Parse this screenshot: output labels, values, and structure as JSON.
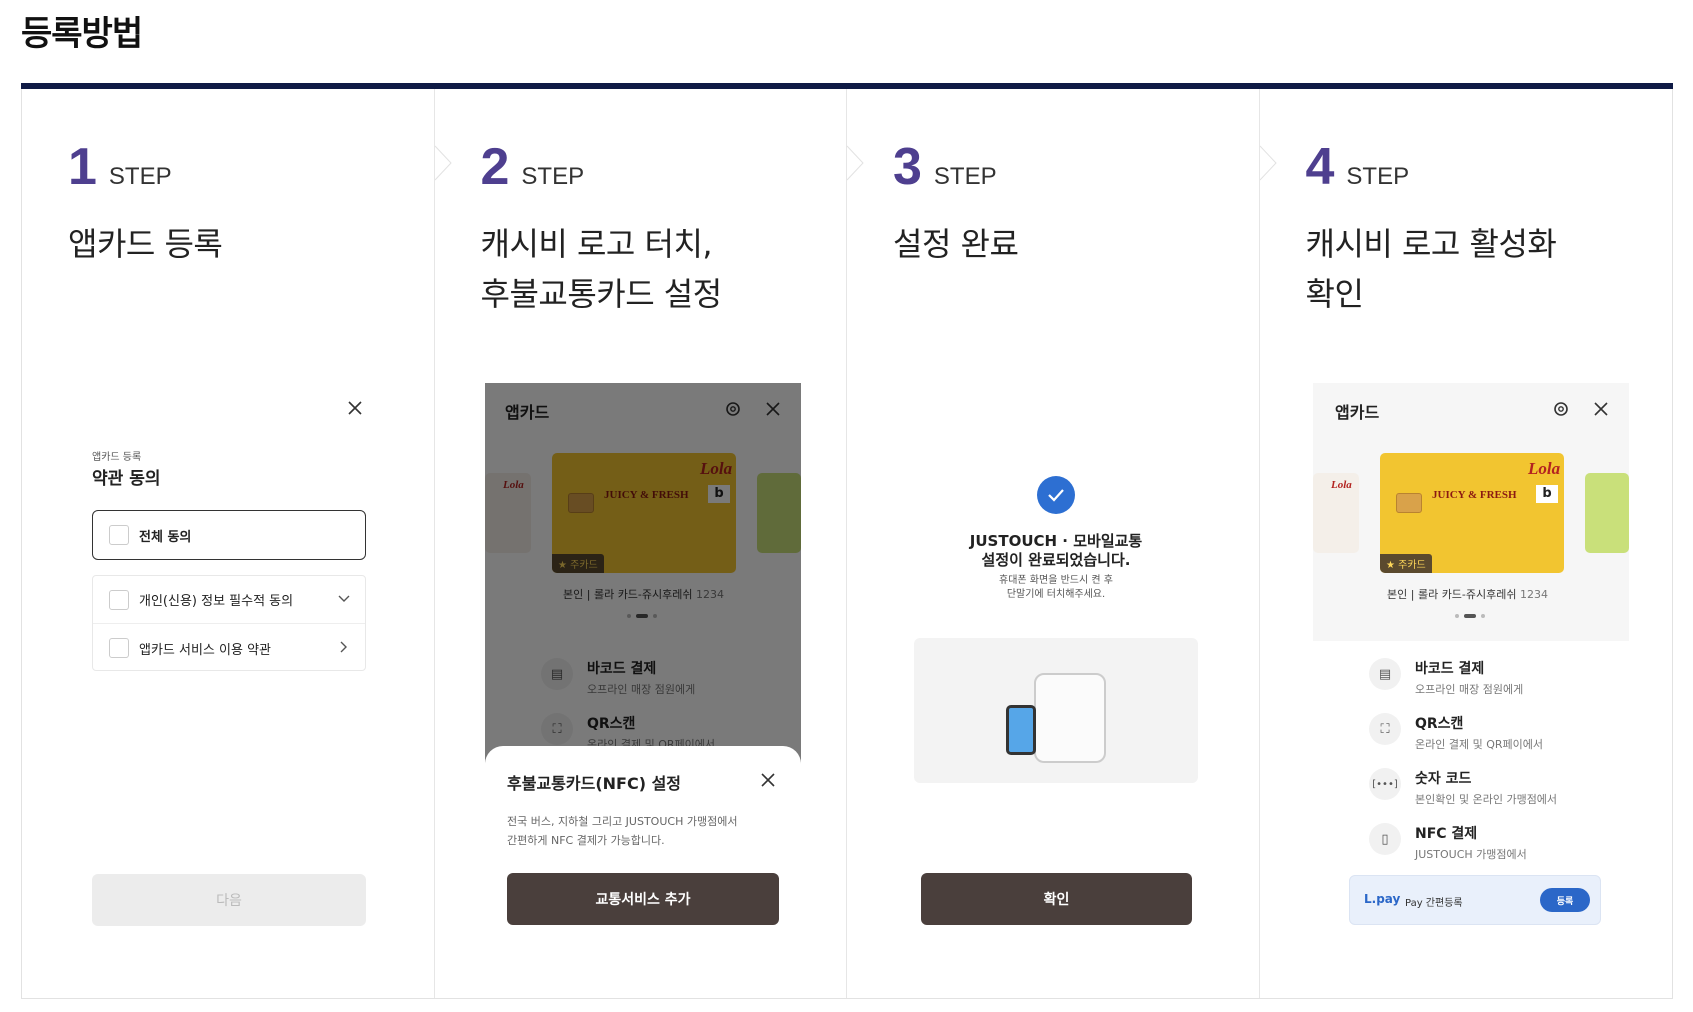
{
  "page": {
    "title": "등록방법"
  },
  "steps": [
    {
      "num": "1",
      "word": "STEP",
      "title_lines": [
        "앱카드 등록"
      ]
    },
    {
      "num": "2",
      "word": "STEP",
      "title_lines": [
        "캐시비 로고 터치,",
        "후불교통카드 설정"
      ]
    },
    {
      "num": "3",
      "word": "STEP",
      "title_lines": [
        "설정 완료"
      ]
    },
    {
      "num": "4",
      "word": "STEP",
      "title_lines": [
        "캐시비 로고 활성화",
        "확인"
      ]
    }
  ],
  "step1": {
    "sub": "앱카드 등록",
    "heading": "약관 동의",
    "all_agree": "전체 동의",
    "terms": [
      "개인(신용) 정보 필수적 동의",
      "앱카드 서비스 이용 약관"
    ],
    "next_button": "다음"
  },
  "appcard": {
    "title": "앱카드",
    "card_brand": "Lola",
    "card_art_text": "JUICY & FRESH",
    "main_badge": "★ 주카드",
    "owner_label": "본인",
    "card_name": "롤라 카드-쥬시후레쉬",
    "card_last4": "1234",
    "menu": [
      {
        "icon": "barcode-icon",
        "title": "바코드 결제",
        "desc": "오프라인 매장 점원에게"
      },
      {
        "icon": "qr-scan-icon",
        "title": "QR스캔",
        "desc": "온라인 결제 및 QR페이에서"
      },
      {
        "icon": "number-code-icon",
        "title": "숫자 코드",
        "desc": "본인확인 및 온라인 가맹점에서"
      },
      {
        "icon": "nfc-icon",
        "title": "NFC 결제",
        "desc": "JUSTOUCH 가맹점에서"
      }
    ]
  },
  "step2": {
    "sheet_title": "후불교통카드(NFC) 설정",
    "sheet_desc_lines": [
      "전국 버스, 지하철 그리고 JUSTOUCH 가맹점에서",
      "간편하게 NFC 결제가 가능합니다."
    ],
    "add_button": "교통서비스 추가"
  },
  "step3": {
    "done_title_lines": [
      "JUSTOUCH · 모바일교통",
      "설정이 완료되었습니다."
    ],
    "done_desc_lines": [
      "휴대폰 화면을 반드시 켠 후",
      "단말기에 터치해주세요."
    ],
    "confirm_button": "확인"
  },
  "step4": {
    "lpay_logo": "L.pay",
    "lpay_text": "Pay 간편등록",
    "lpay_button": "등록"
  },
  "colors": {
    "accent": "#4e3f8f",
    "title_bar": "#0f1a45",
    "dark_button": "#4a3f3c",
    "blue": "#2d6fd2"
  }
}
